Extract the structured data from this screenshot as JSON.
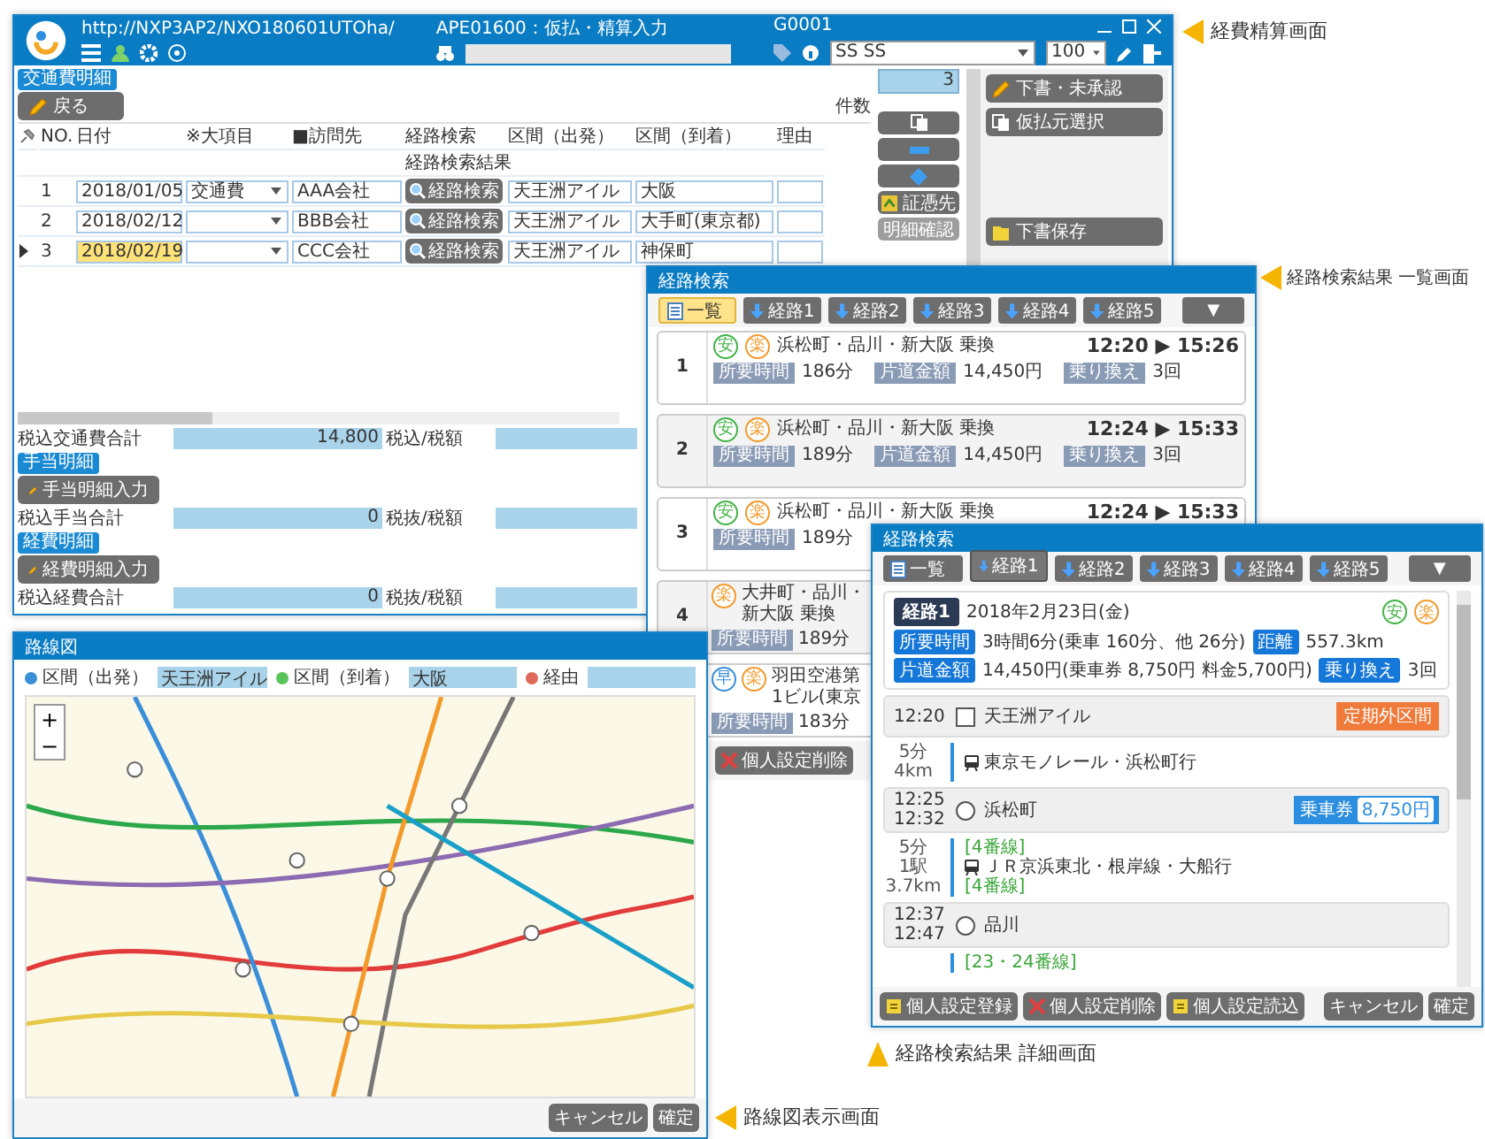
{
  "annotations": [
    "経費精算画面",
    "経路検索結果 一覧画面",
    "経路検索結果 詳細画面",
    "路線図表示画面"
  ],
  "main_window": {
    "url": "http://NXP3AP2/NXO180601UTOha/",
    "screen_title": "APE01600：仮払・精算入力",
    "user_code": "G0001",
    "user_select": "SS SS",
    "zoom_select": "100",
    "section_label": "交通費明細",
    "back_button": "戻る",
    "count_label": "件数",
    "count_value": "3",
    "columns": [
      "NO.",
      "日付",
      "※大項目",
      "■訪問先",
      "経路検索",
      "区間（出発）",
      "区間（到着）",
      "理由"
    ],
    "subheader": "経路検索結果",
    "rows": [
      {
        "no": "1",
        "date": "2018/01/05",
        "category": "交通費",
        "visit": "AAA会社",
        "route_button": "経路検索",
        "from": "天王洲アイル",
        "to": "大阪",
        "selected": false
      },
      {
        "no": "2",
        "date": "2018/02/12",
        "visit": "BBB会社",
        "route_button": "経路検索",
        "from": "天王洲アイル",
        "to": "大手町(東京都)",
        "selected": false
      },
      {
        "no": "3",
        "date": "2018/02/19",
        "visit": "CCC会社",
        "route_button": "経路検索",
        "from": "天王洲アイル",
        "to": "神保町",
        "selected": true
      }
    ],
    "mid_buttons": [
      {
        "kind": "copy",
        "disabled": false
      },
      {
        "kind": "minus",
        "disabled": false
      },
      {
        "kind": "plus",
        "disabled": false
      },
      {
        "kind": "voucher",
        "label": "証憑先",
        "disabled": false
      },
      {
        "kind": "text",
        "label": "明細確認",
        "disabled": true
      }
    ],
    "side_buttons": [
      {
        "kind": "pencil",
        "label": "下書・未承認"
      },
      {
        "kind": "copy",
        "label": "仮払元選択"
      },
      {
        "kind": "folder",
        "label": "下書保存"
      }
    ],
    "transport_total": {
      "label": "税込交通費合計",
      "value": "14,800",
      "tax_label": "税込/税額"
    },
    "sections": [
      {
        "label": "手当明細",
        "button": "手当明細入力",
        "total_label": "税込手当合計",
        "value": "0",
        "tax_label": "税抜/税額"
      },
      {
        "label": "経費明細",
        "button": "経費明細入力",
        "total_label": "税込経費合計",
        "value": "0",
        "tax_label": "税抜/税額"
      }
    ]
  },
  "list_window": {
    "title": "経路検索",
    "more_button": "▼",
    "tabs": [
      {
        "label": "一覧",
        "selected": true
      },
      {
        "label": "経路1",
        "selected": false
      },
      {
        "label": "経路2",
        "selected": false
      },
      {
        "label": "経路3",
        "selected": false
      },
      {
        "label": "経路4",
        "selected": false
      },
      {
        "label": "経路5",
        "selected": false
      }
    ],
    "routes": [
      {
        "no": "1",
        "badges": [
          {
            "text": "安",
            "color": "#43b549"
          },
          {
            "text": "楽",
            "color": "#f39a2b"
          }
        ],
        "route": "浜松町・品川・新大阪 乗換",
        "time": "12:20 ▶ 15:26",
        "tags": [
          {
            "label": "所要時間",
            "value": "186分"
          },
          {
            "label": "片道金額",
            "value": "14,450円"
          },
          {
            "label": "乗り換え",
            "value": "3回"
          }
        ]
      },
      {
        "no": "2",
        "badges": [
          {
            "text": "安",
            "color": "#43b549"
          },
          {
            "text": "楽",
            "color": "#f39a2b"
          }
        ],
        "route": "浜松町・品川・新大阪 乗換",
        "time": "12:24 ▶ 15:33",
        "tags": [
          {
            "label": "所要時間",
            "value": "189分"
          },
          {
            "label": "片道金額",
            "value": "14,450円"
          },
          {
            "label": "乗り換え",
            "value": "3回"
          }
        ]
      },
      {
        "no": "3",
        "badges": [
          {
            "text": "安",
            "color": "#43b549"
          },
          {
            "text": "楽",
            "color": "#f39a2b"
          }
        ],
        "route": "浜松町・品川・新大阪 乗換",
        "time": "12:24 ▶ 15:33",
        "tags": [
          {
            "label": "所要時間",
            "value": "189分"
          }
        ]
      },
      {
        "no": "4",
        "badges": [
          {
            "text": "楽",
            "color": "#f39a2b"
          }
        ],
        "route": "大井町・品川・新大阪 乗換",
        "tags": [
          {
            "label": "所要時間",
            "value": "189分"
          }
        ]
      },
      {
        "badges": [
          {
            "text": "早",
            "color": "#3b8fd9"
          },
          {
            "text": "楽",
            "color": "#f39a2b"
          }
        ],
        "route": "羽田空港第1ビル(東京",
        "tags": [
          {
            "label": "所要時間",
            "value": "183分"
          }
        ]
      }
    ],
    "footer_buttons": [
      {
        "kind": "delete",
        "label": "個人設定削除"
      }
    ]
  },
  "detail_window": {
    "title": "経路検索",
    "more_button": "▼",
    "tabs": [
      {
        "label": "一覧",
        "selected": false
      },
      {
        "label": "経路1",
        "selected": true
      },
      {
        "label": "経路2",
        "selected": false
      },
      {
        "label": "経路3",
        "selected": false
      },
      {
        "label": "経路4",
        "selected": false
      },
      {
        "label": "経路5",
        "selected": false
      }
    ],
    "route_badge": "経路1",
    "date": "2018年2月23日(金)",
    "badges": [
      {
        "text": "安",
        "color": "#43b549"
      },
      {
        "text": "楽",
        "color": "#f39a2b"
      }
    ],
    "facts": [
      {
        "label": "所要時間",
        "value": "3時間6分(乗車 160分、他 26分)"
      },
      {
        "label": "距離",
        "value": "557.3km"
      },
      {
        "label": "片道金額",
        "value": "14,450円(乗車券 8,750円 料金5,700円)"
      },
      {
        "label": "乗り換え",
        "value": "3回"
      }
    ],
    "timeline": [
      {
        "kind": "start",
        "times": [
          "12:20"
        ],
        "name": "天王洲アイル",
        "action": "定期外区間"
      },
      {
        "kind": "segment",
        "stats": [
          "5分",
          "4km"
        ],
        "lines": [
          {
            "kind": "train",
            "text": "東京モノレール・浜松町行"
          }
        ]
      },
      {
        "kind": "stop",
        "times": [
          "12:25",
          "12:32"
        ],
        "name": "浜松町",
        "fare_label": "乗車券",
        "fare": "8,750円"
      },
      {
        "kind": "segment",
        "stats": [
          "5分",
          "1駅",
          "3.7km"
        ],
        "lines": [
          {
            "kind": "platform",
            "text": "[4番線]"
          },
          {
            "kind": "train",
            "text": "ＪＲ京浜東北・根岸線・大船行"
          },
          {
            "kind": "platform",
            "text": "[4番線]"
          }
        ]
      },
      {
        "kind": "stop",
        "times": [
          "12:37",
          "12:47"
        ],
        "name": "品川"
      },
      {
        "kind": "segment",
        "lines": [
          {
            "kind": "platform",
            "text": "[23・24番線]"
          }
        ]
      }
    ],
    "footer_buttons": [
      {
        "kind": "save",
        "label": "個人設定登録"
      },
      {
        "kind": "delete",
        "label": "個人設定削除"
      },
      {
        "kind": "load",
        "label": "個人設定読込"
      }
    ],
    "cancel": "キャンセル",
    "confirm": "確定"
  },
  "map_window": {
    "title": "路線図",
    "fields": [
      {
        "label": "区間（出発）",
        "value": "天王洲アイル",
        "color": "#3b8fd9"
      },
      {
        "label": "区間（到着）",
        "value": "大阪",
        "color": "#58c45a"
      },
      {
        "label": "経由",
        "color": "#e06a5a"
      }
    ],
    "zoom_in": "+",
    "zoom_out": "−",
    "cancel": "キャンセル",
    "confirm": "確定"
  }
}
